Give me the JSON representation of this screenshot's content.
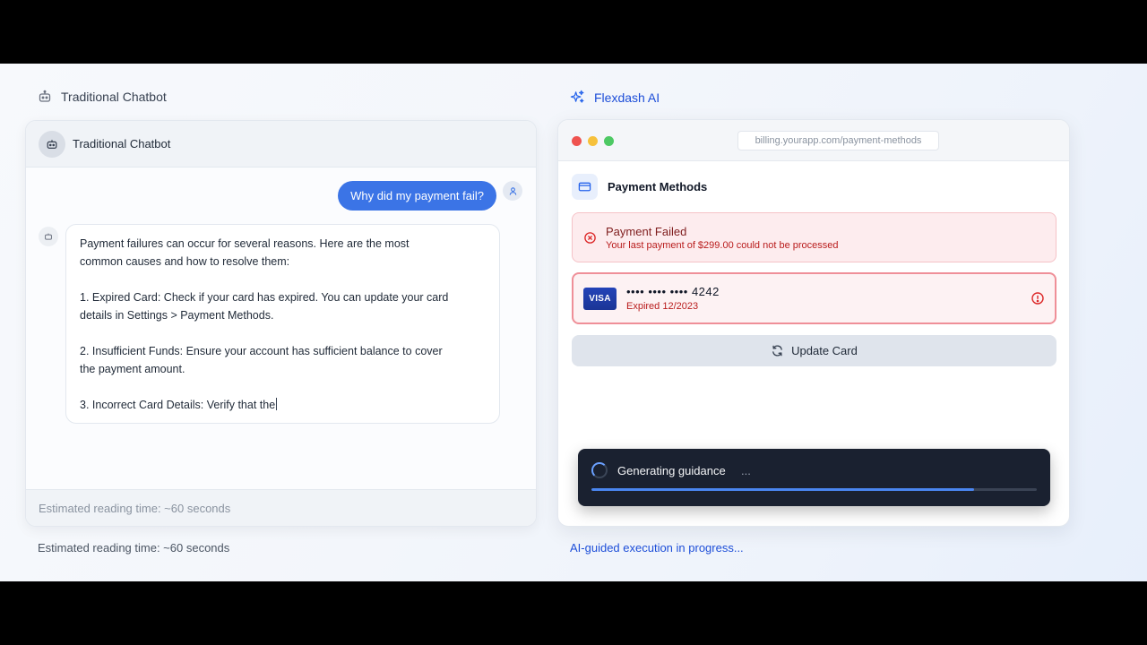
{
  "left_section": {
    "label": "Traditional Chatbot",
    "icon": "robot-icon",
    "chat": {
      "header_title": "Traditional Chatbot",
      "user_message": "Why did my payment fail?",
      "bot_lines": [
        "Payment failures can occur for several reasons. Here are the most",
        "common causes and how to resolve them:",
        "1. Expired Card: Check if your card has expired. You can update your card",
        "details in Settings > Payment Methods.",
        "2. Insufficient Funds: Ensure your account has sufficient balance to cover",
        "the payment amount.",
        "3. Incorrect Card Details: Verify that the"
      ],
      "footer_text": "Estimated reading time: ~60 seconds"
    },
    "caption": "Estimated reading time: ~60 seconds"
  },
  "right_section": {
    "label": "Flexdash AI",
    "icon": "sparkles-icon",
    "browser": {
      "url": "billing.yourapp.com/payment-methods",
      "page_title": "Payment Methods",
      "alert": {
        "title": "Payment Failed",
        "message": "Your last payment of $299.00 could not be processed"
      },
      "card": {
        "brand": "VISA",
        "number": "•••• •••• •••• 4242",
        "expiry": "Expired 12/2023"
      },
      "update_button": "Update Card",
      "toast": {
        "text": "Generating guidance",
        "ellipsis": "...",
        "progress": 0.86
      }
    },
    "caption": "AI-guided execution in progress..."
  },
  "colors": {
    "accent_blue": "#3b74e6",
    "error_red": "#b91c1c",
    "toast_bg": "#1a2130",
    "progress_blue": "#4a86f0"
  }
}
